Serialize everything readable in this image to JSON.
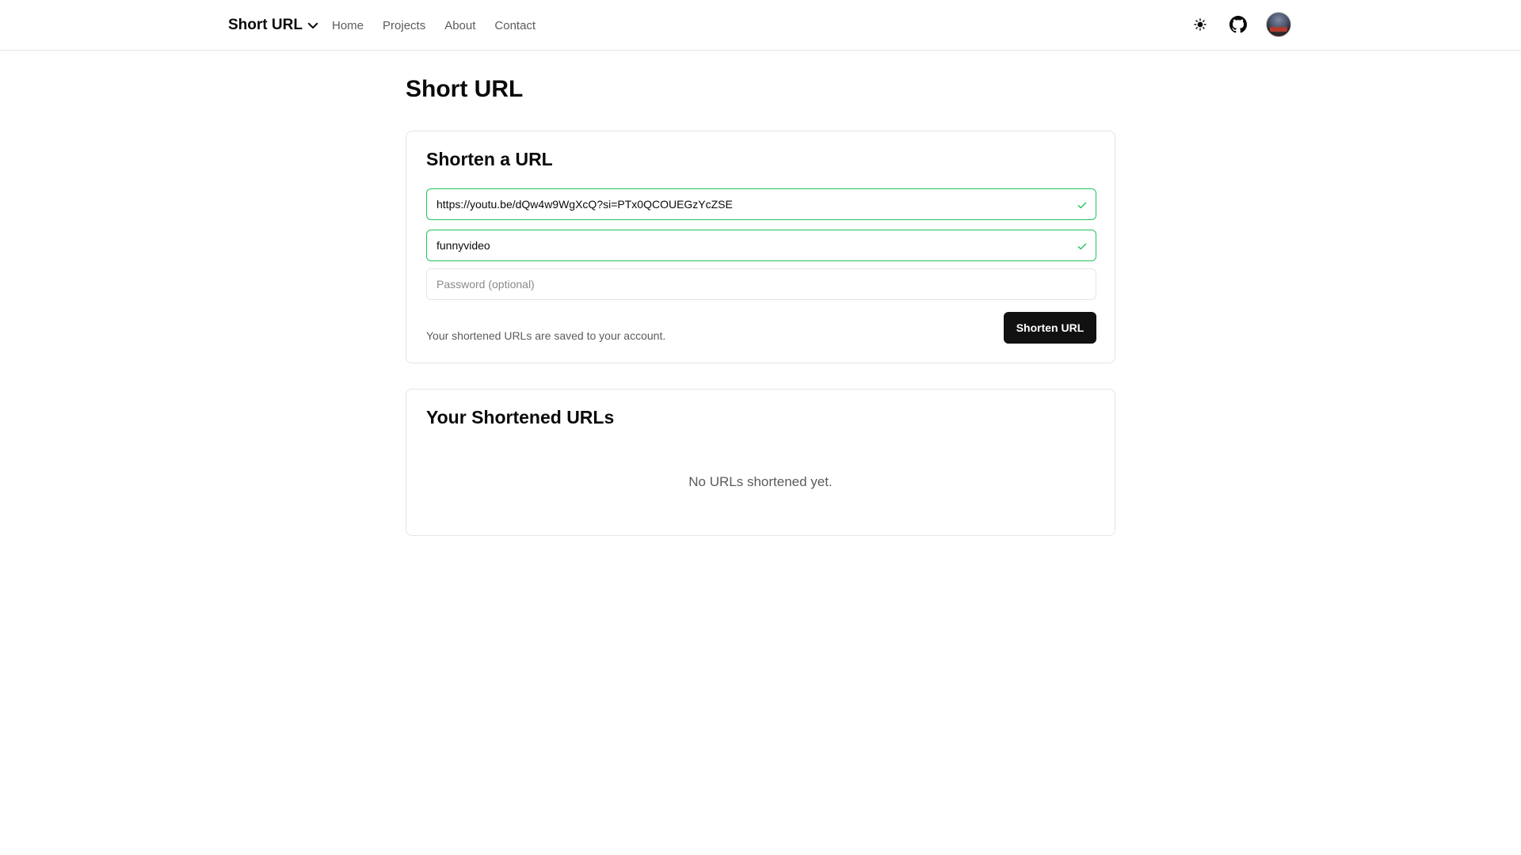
{
  "header": {
    "brand": "Short URL",
    "nav": [
      "Home",
      "Projects",
      "About",
      "Contact"
    ]
  },
  "page": {
    "title": "Short URL"
  },
  "shorten_card": {
    "title": "Shorten a URL",
    "url_value": "https://youtu.be/dQw4w9WgXcQ?si=PTx0QCOUEGzYcZSE",
    "alias_value": "funnyvideo",
    "password_placeholder": "Password (optional)",
    "note": "Your shortened URLs are saved to your account.",
    "submit_label": "Shorten URL"
  },
  "list_card": {
    "title": "Your Shortened URLs",
    "empty_text": "No URLs shortened yet."
  },
  "colors": {
    "valid_border": "#22c55e",
    "button_bg": "#111111",
    "muted_text": "#5c5c5c"
  },
  "icons": {
    "brand_chevron": "chevron-down-icon",
    "theme": "sun-icon",
    "github": "github-icon",
    "field_valid": "check-icon"
  }
}
